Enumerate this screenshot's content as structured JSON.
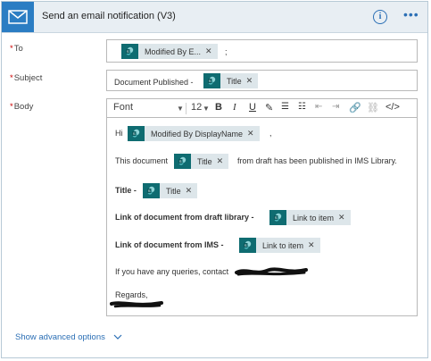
{
  "header": {
    "title": "Send an email notification (V3)",
    "icon": "mail-icon",
    "accent": "#2b7dc3"
  },
  "fields": {
    "to": {
      "label": "To",
      "token": "Modified By E...",
      "trailing": ";"
    },
    "subject": {
      "label": "Subject",
      "prefix": "Document Published -",
      "token": "Title"
    },
    "body": {
      "label": "Body"
    }
  },
  "toolbar": {
    "font": "Font",
    "size": "12",
    "buttons": [
      "bold-icon",
      "italic-icon",
      "underline-icon",
      "highlight-icon",
      "bulleted-list-icon",
      "numbered-list-icon",
      "decrease-indent-icon",
      "increase-indent-icon",
      "link-icon",
      "unlink-icon",
      "code-view-icon"
    ]
  },
  "editor": {
    "line1": {
      "prefix": "Hi",
      "token": "Modified By DisplayName",
      "suffix": ","
    },
    "line2": {
      "prefix": "This document",
      "token": "Title",
      "suffix": "from draft has been published in IMS Library."
    },
    "line3": {
      "prefix": "Title -",
      "token": "Title"
    },
    "line4": {
      "prefix": "Link of document from draft library -",
      "token": "Link to item"
    },
    "line5": {
      "prefix": "Link of document from IMS -",
      "token": "Link to item"
    },
    "line6": {
      "text": "If you have any queries, contact"
    },
    "line7": {
      "text": "Regards,"
    }
  },
  "footer": {
    "advanced": "Show advanced options"
  },
  "colors": {
    "token_icon": "#0f6c71",
    "token_bg": "#dde6ea",
    "link": "#2b6fb5",
    "required": "#cc0000"
  }
}
